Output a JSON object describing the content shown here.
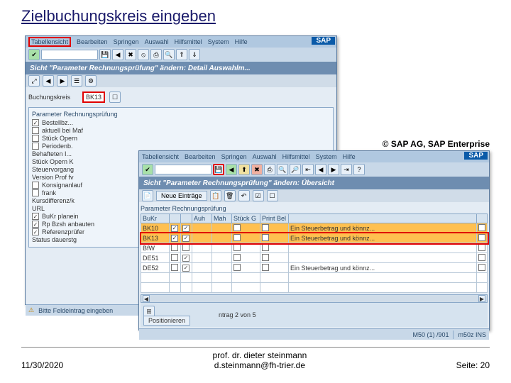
{
  "slide": {
    "title": "Zielbuchungskreis eingeben",
    "copyright": "© SAP AG, SAP Enterprise",
    "footer_date": "11/30/2020",
    "footer_author": "prof. dr. dieter steinmann",
    "footer_email": "d.steinmann@fh-trier.de",
    "footer_page": "Seite: 20"
  },
  "sap": {
    "logo": "SAP"
  },
  "menuA": {
    "m0": "Tabellensicht",
    "m1": "Bearbeiten",
    "m2": "Springen",
    "m3": "Auswahl",
    "m4": "Hilfsmittel",
    "m5": "System",
    "m6": "Hilfe"
  },
  "menuB": {
    "m0": "Tabellensicht",
    "m1": "Bearbeiten",
    "m2": "Springen",
    "m3": "Auswahl",
    "m4": "Hilfsmittel",
    "m5": "System",
    "m6": "Hilfe"
  },
  "winA": {
    "titlebar": "Sicht \"Parameter Rechnungsprüfung\" ändern: Detail Auswahlm...",
    "label_bukrs": "Buchungskreis",
    "value_bukrs": "BK13",
    "group_hdr": "Parameter Rechnungsprüfung",
    "checks": {
      "c0": "Bestellbz...",
      "c1": "aktuell bei Maf",
      "c2": "Stück Opern",
      "c3": "Periodenb.",
      "c4": "Behafteten I...",
      "c5": "Stück Opern K",
      "c6": "Steuervorgang",
      "c7": "Version Prof fv",
      "c8": "Konsignanlauf",
      "c9": "frank",
      "c10": "Kursdifferenz/k",
      "c11": "URL",
      "c12": "BuKr planein",
      "c13": "Rp Bzsh anbauten",
      "c14": "Referenzprüfer",
      "c15": "Status dauerstg"
    },
    "status": "Bitte Feldeintrag eingeben"
  },
  "winB": {
    "titlebar": "Sicht \"Parameter Rechnungsprüfung\" ändern: Übersicht",
    "newentries": "Neue Einträge",
    "group_hdr": "Parameter Rechnungsprüfung",
    "cols": {
      "c0": "BuKr",
      "c1": "",
      "c2": "",
      "c3": "Auh",
      "c4": "Mah",
      "c5": "Stück G",
      "c6": "Print Bel",
      "c7": ""
    },
    "rows": {
      "r0": {
        "bukr": "BK10",
        "desc": "Ein Steuerbetrag und könnz..."
      },
      "r1": {
        "bukr": "BK13",
        "desc": "Ein Steuerbetrag und könnz..."
      },
      "r2": {
        "bukr": "BfW",
        "desc": ""
      },
      "r3": {
        "bukr": "DE51",
        "desc": ""
      },
      "r4": {
        "bukr": "DE52",
        "desc": "Ein Steuerbetrag und könnz..."
      }
    },
    "pos_btn": "Positionieren",
    "pos_info": "ntrag 2 von 5",
    "status_left": "",
    "status_mid": "M50 (1) /901",
    "status_right": "m50z   INS"
  }
}
